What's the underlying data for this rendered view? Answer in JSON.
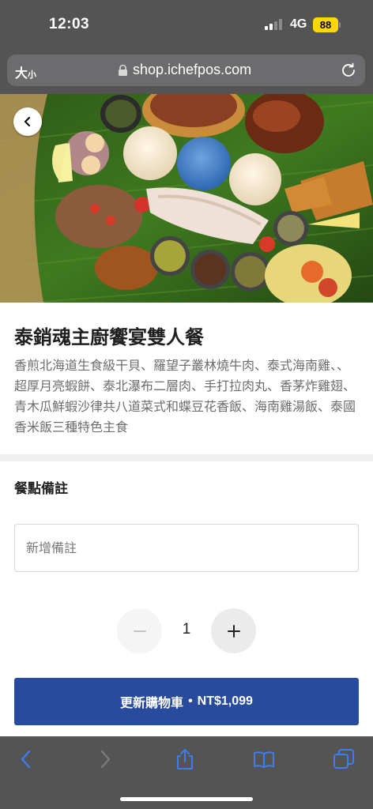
{
  "status_bar": {
    "time": "12:03",
    "network": "4G",
    "battery": "88"
  },
  "browser": {
    "text_size": "大",
    "text_size_small": "小",
    "url": "shop.ichefpos.com"
  },
  "product": {
    "title": "泰銷魂主廚饗宴雙人餐",
    "description": "香煎北海道生食級干貝、羅望子叢林燒牛肉、泰式海南雞、、超厚月亮蝦餅、泰北瀑布二層肉、手打拉肉丸、香茅炸雞翅、青木瓜鮮蝦沙律共八道菜式和蝶豆花香飯、海南雞湯飯、泰國香米飯三種特色主食"
  },
  "note": {
    "label": "餐點備註",
    "placeholder": "新增備註",
    "value": ""
  },
  "quantity": {
    "value": "1"
  },
  "cta": {
    "label": "更新購物車",
    "separator": "•",
    "price": "NT$1,099"
  },
  "colors": {
    "accent": "#294b9e",
    "toolbar_icon": "#3d7cf2"
  },
  "icons": [
    "back-chevron-icon",
    "lock-icon",
    "reload-icon",
    "minus-icon",
    "plus-icon",
    "share-icon",
    "bookmarks-icon",
    "tabs-icon"
  ]
}
